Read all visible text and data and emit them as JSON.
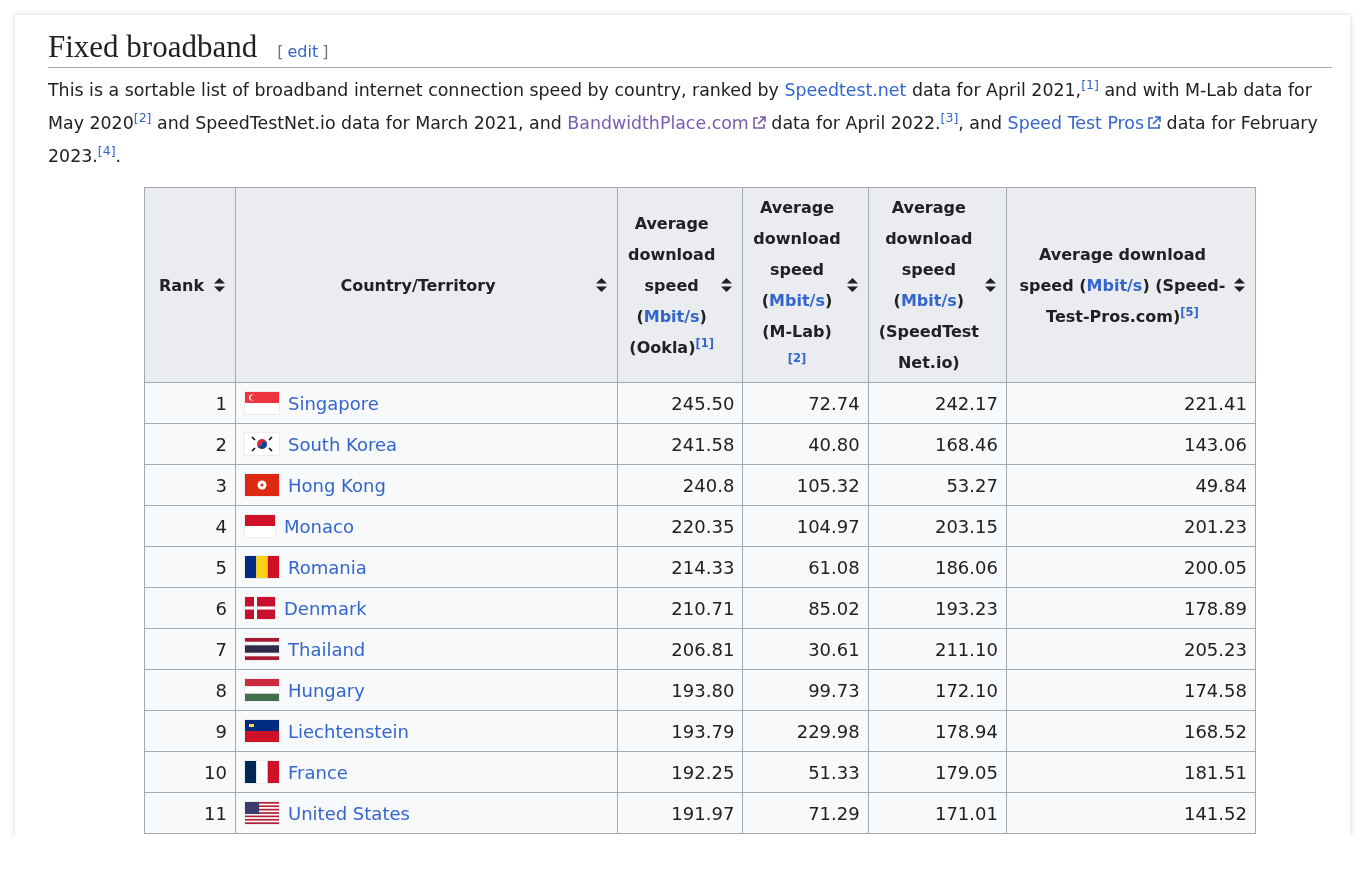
{
  "section": {
    "title": "Fixed broadband",
    "edit_open": "[",
    "edit_link": "edit",
    "edit_close": "]"
  },
  "intro": [
    {
      "kind": "text",
      "text": "This is a sortable list of broadband internet connection speed by country, ranked by "
    },
    {
      "kind": "link",
      "text": "Speedtest.net",
      "visited": false,
      "external": false
    },
    {
      "kind": "text",
      "text": " data for April 2021,"
    },
    {
      "kind": "ref",
      "text": "[1]"
    },
    {
      "kind": "text",
      "text": " and with M-Lab data for May 2020"
    },
    {
      "kind": "ref",
      "text": "[2]"
    },
    {
      "kind": "text",
      "text": " and SpeedTestNet.io data for March 2021, and "
    },
    {
      "kind": "link",
      "text": "BandwidthPlace.com",
      "visited": true,
      "external": true
    },
    {
      "kind": "text",
      "text": " data for April 2022."
    },
    {
      "kind": "ref",
      "text": "[3]"
    },
    {
      "kind": "text",
      "text": ", and "
    },
    {
      "kind": "link",
      "text": "Speed Test Pros",
      "visited": false,
      "external": true
    },
    {
      "kind": "text",
      "text": " data for February 2023."
    },
    {
      "kind": "ref",
      "text": "[4]"
    },
    {
      "kind": "text",
      "text": "."
    }
  ],
  "table": {
    "columns": [
      {
        "parts": [
          {
            "kind": "text",
            "text": "Rank"
          }
        ]
      },
      {
        "parts": [
          {
            "kind": "text",
            "text": "Country/Territory"
          }
        ]
      },
      {
        "parts": [
          {
            "kind": "text",
            "text": "Average download speed ("
          },
          {
            "kind": "link",
            "text": "Mbit/s"
          },
          {
            "kind": "text",
            "text": ") (Ookla)"
          },
          {
            "kind": "ref",
            "text": "[1]"
          }
        ]
      },
      {
        "parts": [
          {
            "kind": "text",
            "text": "Average download speed ("
          },
          {
            "kind": "link",
            "text": "Mbit/s"
          },
          {
            "kind": "text",
            "text": ") (M-Lab)"
          },
          {
            "kind": "ref",
            "text": "[2]"
          }
        ]
      },
      {
        "parts": [
          {
            "kind": "text",
            "text": "Average download speed ("
          },
          {
            "kind": "link",
            "text": "Mbit/s"
          },
          {
            "kind": "text",
            "text": ") (SpeedTest Net.io)"
          }
        ]
      },
      {
        "parts": [
          {
            "kind": "text",
            "text": "Average download speed ("
          },
          {
            "kind": "link",
            "text": "Mbit/s"
          },
          {
            "kind": "text",
            "text": ") (Speed-Test-Pros.com)"
          },
          {
            "kind": "ref",
            "text": "[5]"
          }
        ]
      }
    ],
    "rows": [
      {
        "rank": "1",
        "kind": "sg",
        "country": "Singapore",
        "values": [
          "245.50",
          "72.74",
          "242.17",
          "221.41"
        ]
      },
      {
        "rank": "2",
        "kind": "kr",
        "country": "South Korea",
        "values": [
          "241.58",
          "40.80",
          "168.46",
          "143.06"
        ]
      },
      {
        "rank": "3",
        "kind": "hk",
        "country": "Hong Kong",
        "values": [
          "240.8",
          "105.32",
          "53.27",
          "49.84"
        ]
      },
      {
        "rank": "4",
        "kind": "mc",
        "country": "Monaco",
        "values": [
          "220.35",
          "104.97",
          "203.15",
          "201.23"
        ]
      },
      {
        "rank": "5",
        "kind": "ro",
        "country": "Romania",
        "values": [
          "214.33",
          "61.08",
          "186.06",
          "200.05"
        ]
      },
      {
        "rank": "6",
        "kind": "dk",
        "country": "Denmark",
        "values": [
          "210.71",
          "85.02",
          "193.23",
          "178.89"
        ]
      },
      {
        "rank": "7",
        "kind": "th",
        "country": "Thailand",
        "values": [
          "206.81",
          "30.61",
          "211.10",
          "205.23"
        ]
      },
      {
        "rank": "8",
        "kind": "hu",
        "country": "Hungary",
        "values": [
          "193.80",
          "99.73",
          "172.10",
          "174.58"
        ]
      },
      {
        "rank": "9",
        "kind": "li",
        "country": "Liechtenstein",
        "values": [
          "193.79",
          "229.98",
          "178.94",
          "168.52"
        ]
      },
      {
        "rank": "10",
        "kind": "fr",
        "country": "France",
        "values": [
          "192.25",
          "51.33",
          "179.05",
          "181.51"
        ]
      },
      {
        "rank": "11",
        "kind": "us",
        "country": "United States",
        "values": [
          "191.97",
          "71.29",
          "171.01",
          "141.52"
        ]
      }
    ]
  }
}
